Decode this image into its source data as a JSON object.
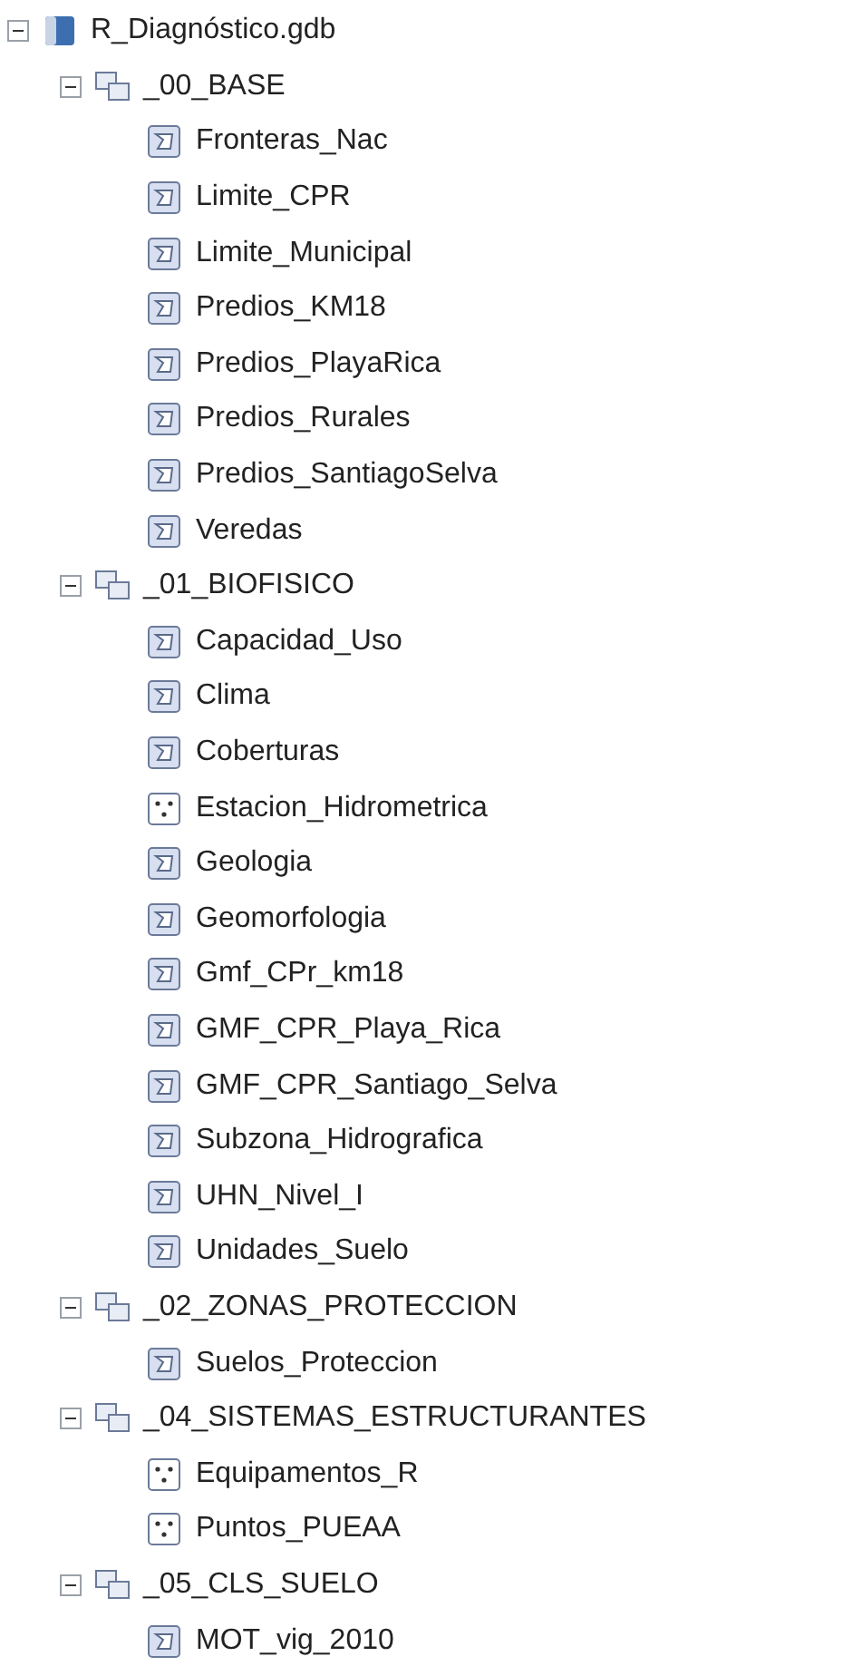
{
  "tree": [
    {
      "label": "R_Diagnóstico.gdb",
      "kind": "geodatabase",
      "expanded": true,
      "children": [
        {
          "label": "_00_BASE",
          "kind": "dataset",
          "expanded": true,
          "children": [
            {
              "label": "Fronteras_Nac",
              "kind": "polygon"
            },
            {
              "label": "Limite_CPR",
              "kind": "polygon"
            },
            {
              "label": "Limite_Municipal",
              "kind": "polygon"
            },
            {
              "label": "Predios_KM18",
              "kind": "polygon"
            },
            {
              "label": "Predios_PlayaRica",
              "kind": "polygon"
            },
            {
              "label": "Predios_Rurales",
              "kind": "polygon"
            },
            {
              "label": "Predios_SantiagoSelva",
              "kind": "polygon"
            },
            {
              "label": "Veredas",
              "kind": "polygon"
            }
          ]
        },
        {
          "label": "_01_BIOFISICO",
          "kind": "dataset",
          "expanded": true,
          "children": [
            {
              "label": "Capacidad_Uso",
              "kind": "polygon"
            },
            {
              "label": "Clima",
              "kind": "polygon"
            },
            {
              "label": "Coberturas",
              "kind": "polygon"
            },
            {
              "label": "Estacion_Hidrometrica",
              "kind": "point"
            },
            {
              "label": "Geologia",
              "kind": "polygon"
            },
            {
              "label": "Geomorfologia",
              "kind": "polygon"
            },
            {
              "label": "Gmf_CPr_km18",
              "kind": "polygon"
            },
            {
              "label": "GMF_CPR_Playa_Rica",
              "kind": "polygon"
            },
            {
              "label": "GMF_CPR_Santiago_Selva",
              "kind": "polygon"
            },
            {
              "label": "Subzona_Hidrografica",
              "kind": "polygon"
            },
            {
              "label": "UHN_Nivel_I",
              "kind": "polygon"
            },
            {
              "label": "Unidades_Suelo",
              "kind": "polygon"
            }
          ]
        },
        {
          "label": "_02_ZONAS_PROTECCION",
          "kind": "dataset",
          "expanded": true,
          "children": [
            {
              "label": "Suelos_Proteccion",
              "kind": "polygon"
            }
          ]
        },
        {
          "label": "_04_SISTEMAS_ESTRUCTURANTES",
          "kind": "dataset",
          "expanded": true,
          "children": [
            {
              "label": "Equipamentos_R",
              "kind": "point"
            },
            {
              "label": "Puntos_PUEAA",
              "kind": "point"
            }
          ]
        },
        {
          "label": "_05_CLS_SUELO",
          "kind": "dataset",
          "expanded": true,
          "children": [
            {
              "label": "MOT_vig_2010",
              "kind": "polygon"
            }
          ]
        }
      ]
    }
  ]
}
